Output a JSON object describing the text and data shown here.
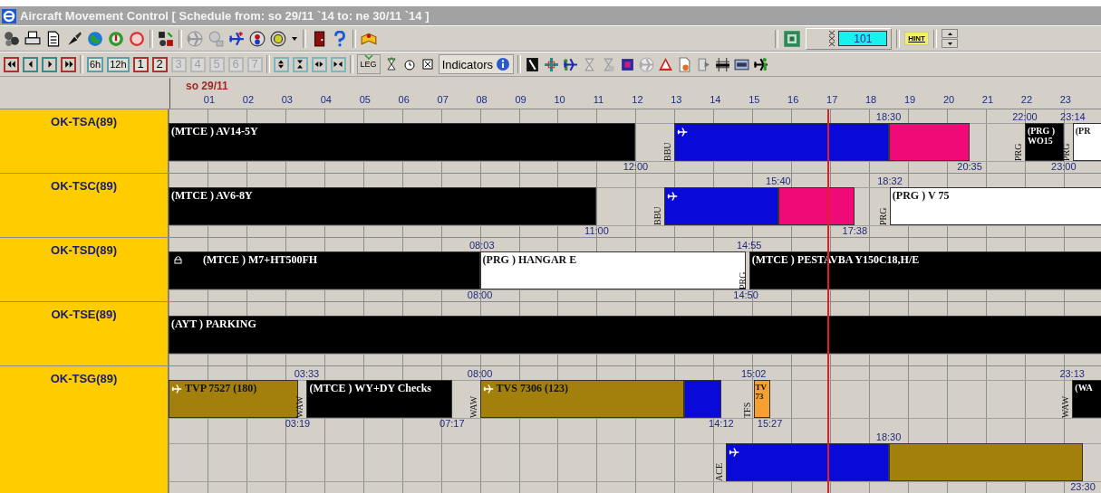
{
  "window": {
    "title": "Aircraft Movement Control [ Schedule from: so 29/11 `14 to: ne 30/11 `14 ]"
  },
  "toolbar_top": {
    "counter": "101",
    "hint_button": "HINT"
  },
  "toolbar_nav": {
    "range_buttons": [
      {
        "label": "6h",
        "disabled": false
      },
      {
        "label": "12h",
        "disabled": false
      },
      {
        "label": "1",
        "disabled": false
      },
      {
        "label": "2",
        "disabled": false
      },
      {
        "label": "3",
        "disabled": true
      },
      {
        "label": "4",
        "disabled": true
      },
      {
        "label": "5",
        "disabled": true
      },
      {
        "label": "6",
        "disabled": true
      },
      {
        "label": "7",
        "disabled": true
      }
    ],
    "leg_button": "LEG",
    "indicators_button": "Indicators"
  },
  "timeline": {
    "date": "so 29/11",
    "hours": [
      "01",
      "02",
      "03",
      "04",
      "05",
      "06",
      "07",
      "08",
      "09",
      "10",
      "11",
      "12",
      "13",
      "14",
      "15",
      "16",
      "17",
      "18",
      "19",
      "20",
      "21",
      "22",
      "23"
    ]
  },
  "aircraft": [
    {
      "registration": "OK-TSA(89)",
      "lanes": [
        {
          "bars": [
            {
              "plane": false,
              "lock": false,
              "text": "(MTCE ) AV14-5Y",
              "segments": [
                {
                  "color": "#000000"
                }
              ]
            },
            {
              "station": "BBU",
              "plane": true,
              "lock": false,
              "segments": [
                {
                  "color": "#0a0ad8"
                },
                {
                  "color": "#f00a78"
                }
              ]
            },
            {
              "station": "PRG",
              "plane": false,
              "lock": false,
              "text": "(PRG ) WO15",
              "segments": [
                {
                  "color": "#000000"
                }
              ]
            },
            {
              "station": "PRG",
              "plane": false,
              "lock": false,
              "text": "(PR",
              "segments": [
                {
                  "color": "#ffffff"
                }
              ]
            }
          ],
          "times_above": [
            "18:30",
            "22:00",
            "23:14"
          ],
          "times_below": [
            "12:00",
            "20:35",
            "23:00"
          ]
        }
      ]
    },
    {
      "registration": "OK-TSC(89)",
      "lanes": [
        {
          "bars": [
            {
              "plane": false,
              "lock": false,
              "text": "(MTCE ) AV6-8Y",
              "segments": [
                {
                  "color": "#000000"
                }
              ]
            },
            {
              "station": "BBU",
              "plane": true,
              "lock": false,
              "segments": [
                {
                  "color": "#0a0ad8"
                },
                {
                  "color": "#f00a78"
                }
              ]
            },
            {
              "station": "PRG",
              "plane": false,
              "lock": false,
              "text": "(PRG ) V 75",
              "segments": [
                {
                  "color": "#ffffff"
                }
              ]
            }
          ],
          "times_above": [
            "15:40",
            "18:32"
          ],
          "times_below": [
            "11:00",
            "17:38"
          ]
        }
      ]
    },
    {
      "registration": "OK-TSD(89)",
      "lanes": [
        {
          "bars": [
            {
              "plane": false,
              "lock": true,
              "text": "(MTCE ) M7+HT500FH",
              "segments": [
                {
                  "color": "#000000"
                }
              ]
            },
            {
              "plane": false,
              "lock": false,
              "text": "(PRG ) HANGAR E",
              "segments": [
                {
                  "color": "#ffffff"
                }
              ]
            },
            {
              "station": "PRG",
              "plane": false,
              "lock": false,
              "text": "(MTCE ) PESTAVBA Y150C18,H/E",
              "segments": [
                {
                  "color": "#000000"
                }
              ]
            }
          ],
          "times_above": [
            "08:03",
            "14:55"
          ],
          "times_below": [
            "08:00",
            "14:50"
          ]
        }
      ]
    },
    {
      "registration": "OK-TSE(89)",
      "lanes": [
        {
          "bars": [
            {
              "plane": false,
              "lock": false,
              "text": "(AYT ) PARKING",
              "segments": [
                {
                  "color": "#000000"
                }
              ]
            }
          ]
        }
      ]
    },
    {
      "registration": "OK-TSG(89)",
      "lanes": [
        {
          "bars": [
            {
              "plane": true,
              "lock": false,
              "text": "TVP 7527 (180)",
              "segments": [
                {
                  "color": "#a3800c"
                }
              ]
            },
            {
              "station": "WAW",
              "plane": false,
              "lock": false,
              "text": "(MTCE ) WY+DY Checks",
              "segments": [
                {
                  "color": "#000000"
                }
              ]
            },
            {
              "station": "WAW",
              "plane": true,
              "lock": false,
              "text": "TVS 7306 (123)",
              "segments": [
                {
                  "color": "#a3800c"
                },
                {
                  "color": "#0a0ad8"
                }
              ]
            },
            {
              "station": "TFS",
              "plane": false,
              "lock": false,
              "text": "TV 73",
              "segments": [
                {
                  "color": "#f5a030"
                }
              ]
            },
            {
              "station": "WAW",
              "plane": false,
              "lock": false,
              "text": "(WA",
              "segments": [
                {
                  "color": "#000000"
                }
              ]
            }
          ],
          "times_above": [
            "03:33",
            "08:00",
            "15:02",
            "23:13"
          ],
          "times_below": [
            "03:19",
            "07:17",
            "14:12",
            "15:27"
          ]
        },
        {
          "bars": [
            {
              "station": "ACE",
              "plane": true,
              "lock": false,
              "segments": [
                {
                  "color": "#0a0ad8"
                },
                {
                  "color": "#a3800c"
                }
              ]
            }
          ],
          "times_above": [
            "18:30"
          ],
          "times_below": [
            "23:30"
          ]
        }
      ]
    }
  ]
}
